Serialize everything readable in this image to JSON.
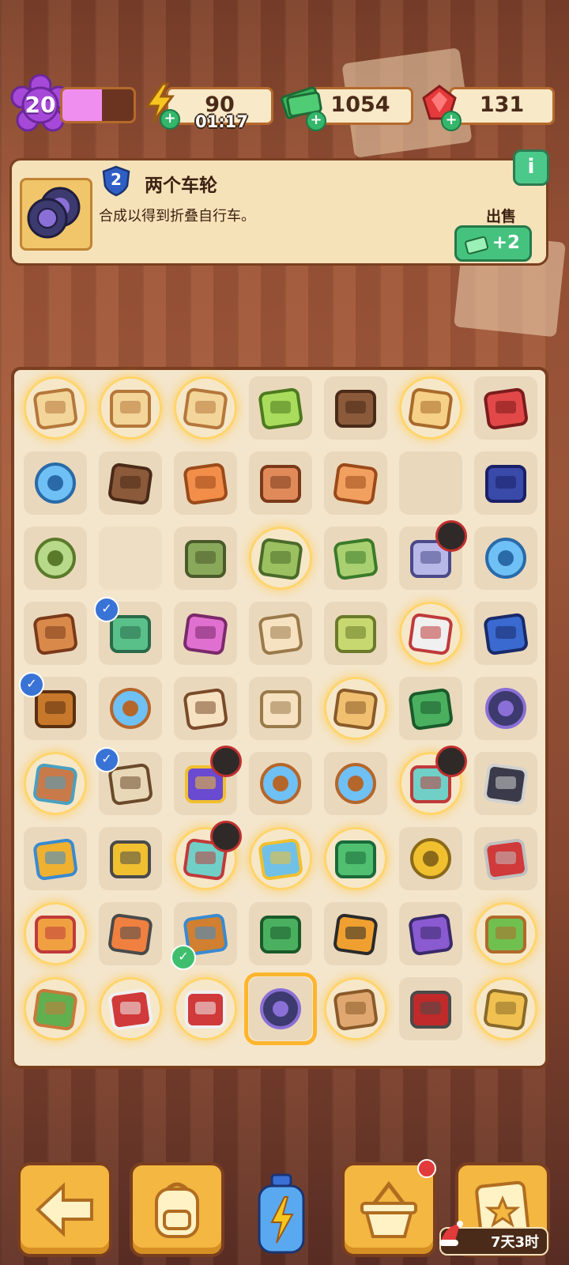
{
  "header": {
    "level": "20",
    "xp_progress": 0.55,
    "energy": {
      "value": "90",
      "timer": "01:17",
      "icon": "lightning-icon"
    },
    "cash": {
      "value": "1054",
      "icon": "cash-icon"
    },
    "gems": {
      "value": "131",
      "icon": "ruby-icon"
    }
  },
  "info_panel": {
    "tier": "2",
    "title": "两个车轮",
    "description": "合成以得到折叠自行车。",
    "sell_label": "出售",
    "sell_value": "+2",
    "info_button": "i"
  },
  "board": {
    "columns": 7,
    "rows": 9,
    "cells": [
      {
        "item": "toast-box",
        "glow": true
      },
      {
        "item": "toast-box",
        "glow": true
      },
      {
        "item": "toast-box",
        "glow": true
      },
      {
        "item": "green-bottle",
        "glow": false
      },
      {
        "item": "star-cookie",
        "glow": false
      },
      {
        "item": "portrait-frame",
        "glow": true
      },
      {
        "item": "red-box",
        "glow": false
      },
      {
        "item": "blue-gem",
        "glow": false
      },
      {
        "item": "cookie-pieces",
        "glow": false
      },
      {
        "item": "orange-pouch",
        "glow": false
      },
      {
        "item": "box-stack",
        "glow": false
      },
      {
        "item": "orange-stack",
        "glow": false
      },
      {
        "item": "empty",
        "glow": false
      },
      {
        "item": "rabbit-poster",
        "glow": false
      },
      {
        "item": "green-oval",
        "glow": false
      },
      {
        "item": "empty-faded",
        "glow": false
      },
      {
        "item": "green-bag",
        "glow": false
      },
      {
        "item": "green-bowl",
        "glow": true
      },
      {
        "item": "green-cushion",
        "glow": false
      },
      {
        "item": "megaphone",
        "glow": false,
        "timer": true
      },
      {
        "item": "blue-gem",
        "glow": false
      },
      {
        "item": "clay-pot",
        "glow": false
      },
      {
        "item": "broom",
        "glow": false,
        "check": true
      },
      {
        "item": "paint-roller",
        "glow": false
      },
      {
        "item": "bread-slices",
        "glow": false
      },
      {
        "item": "money-sack",
        "glow": false
      },
      {
        "item": "toolbox",
        "glow": true
      },
      {
        "item": "detective-poster",
        "glow": false
      },
      {
        "item": "telescope",
        "glow": false,
        "check": true
      },
      {
        "item": "magnifier",
        "glow": false
      },
      {
        "item": "cookie-bag",
        "glow": false
      },
      {
        "item": "bread-slice",
        "glow": false
      },
      {
        "item": "toolbox-gold",
        "glow": true
      },
      {
        "item": "green-brush",
        "glow": false
      },
      {
        "item": "wheel",
        "glow": false
      },
      {
        "item": "crate-scene",
        "glow": true
      },
      {
        "item": "wanted-poster",
        "glow": false,
        "check": true
      },
      {
        "item": "film-projector",
        "glow": false,
        "timer": true
      },
      {
        "item": "magnifier",
        "glow": false
      },
      {
        "item": "magnifier",
        "glow": false
      },
      {
        "item": "bottle-set",
        "glow": true,
        "timer": true
      },
      {
        "item": "faces-poster",
        "glow": false
      },
      {
        "item": "glasses",
        "glow": false
      },
      {
        "item": "barrier",
        "glow": false
      },
      {
        "item": "bottle-set",
        "glow": true,
        "timer": true
      },
      {
        "item": "blue-device",
        "glow": true
      },
      {
        "item": "green-cube",
        "glow": true
      },
      {
        "item": "gold-ring",
        "glow": false
      },
      {
        "item": "red-scissors",
        "glow": false
      },
      {
        "item": "burger-stack",
        "glow": true
      },
      {
        "item": "road-barrier",
        "glow": false
      },
      {
        "item": "binoculars",
        "glow": false,
        "check_green": true
      },
      {
        "item": "green-sprout",
        "glow": false
      },
      {
        "item": "cap-poster",
        "glow": false
      },
      {
        "item": "purple-scooter",
        "glow": false
      },
      {
        "item": "potted-tree",
        "glow": true
      },
      {
        "item": "green-plant-pot",
        "glow": true
      },
      {
        "item": "red-machine",
        "glow": true
      },
      {
        "item": "red-machine",
        "glow": true
      },
      {
        "item": "wheel-pair",
        "glow": false,
        "selected": true
      },
      {
        "item": "crate-pots",
        "glow": true
      },
      {
        "item": "red-pliers",
        "glow": false
      },
      {
        "item": "gold-door",
        "glow": true
      }
    ]
  },
  "bottom_bar": {
    "back_icon": "arrow-left-icon",
    "bag_icon": "backpack-icon",
    "energy_bottle_icon": "energy-bottle-icon",
    "basket_icon": "basket-icon",
    "task_icon": "clipboard-star-icon",
    "event_timer": "7天3时"
  },
  "colors": {
    "panel_border": "#7a3f20",
    "panel_bg": "#f6e2b8",
    "button_green": "#46c27f",
    "button_gold": "#f3b742"
  }
}
